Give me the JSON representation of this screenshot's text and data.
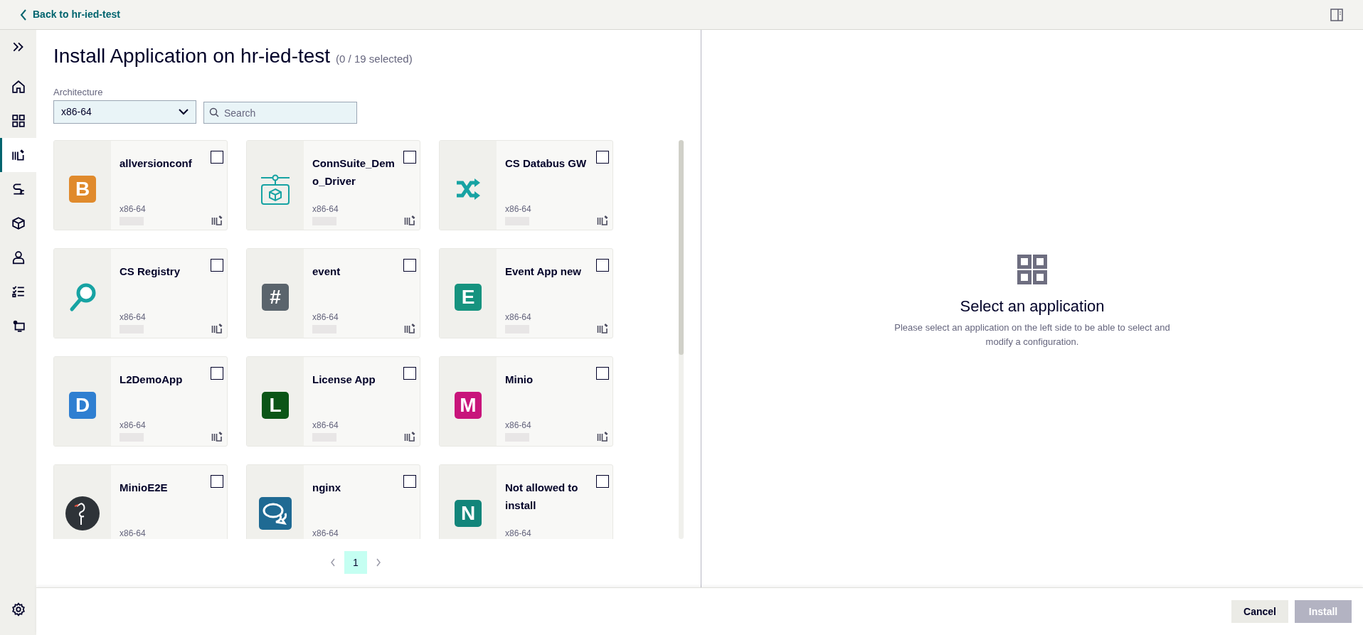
{
  "header": {
    "back_link": "Back to hr-ied-test"
  },
  "sidebar": {
    "items": [
      {
        "kind": "expand",
        "selected": false
      },
      {
        "kind": "home",
        "selected": false
      },
      {
        "kind": "grid",
        "selected": false
      },
      {
        "kind": "apps",
        "selected": true
      },
      {
        "kind": "plug",
        "selected": false
      },
      {
        "kind": "cube",
        "selected": false
      },
      {
        "kind": "user",
        "selected": false
      },
      {
        "kind": "checklist",
        "selected": false
      },
      {
        "kind": "device",
        "selected": false
      }
    ],
    "bottom_item": {
      "kind": "settings",
      "selected": false
    }
  },
  "page": {
    "title": "Install Application on hr-ied-test",
    "selection_count": "(0 / 19 selected)"
  },
  "filters": {
    "architecture": {
      "label": "Architecture",
      "value": "x86-64"
    },
    "search": {
      "placeholder": "Search"
    }
  },
  "apps": [
    {
      "name": "allversionconf",
      "arch": "x86-64",
      "checked": false,
      "icon": {
        "kind": "letter",
        "letter": "B",
        "color": "#e08a2c"
      }
    },
    {
      "name": "ConnSuite_Demo_Driver",
      "arch": "x86-64",
      "checked": false,
      "icon": {
        "kind": "connector",
        "color": "#17a3a3"
      }
    },
    {
      "name": "CS Databus GW",
      "arch": "x86-64",
      "checked": false,
      "icon": {
        "kind": "shuffle",
        "color": "#17a3a3"
      }
    },
    {
      "name": "CS Registry",
      "arch": "x86-64",
      "checked": false,
      "icon": {
        "kind": "magnifier",
        "color": "#17a3a3"
      }
    },
    {
      "name": "event",
      "arch": "x86-64",
      "checked": false,
      "icon": {
        "kind": "letter",
        "letter": "#",
        "color": "#5a646c"
      }
    },
    {
      "name": "Event App new",
      "arch": "x86-64",
      "checked": false,
      "icon": {
        "kind": "letter",
        "letter": "E",
        "color": "#16937f"
      }
    },
    {
      "name": "L2DemoApp",
      "arch": "x86-64",
      "checked": false,
      "icon": {
        "kind": "letter",
        "letter": "D",
        "color": "#2f7fd1"
      }
    },
    {
      "name": "License App",
      "arch": "x86-64",
      "checked": false,
      "icon": {
        "kind": "letter",
        "letter": "L",
        "color": "#0b5517"
      }
    },
    {
      "name": "Minio",
      "arch": "x86-64",
      "checked": false,
      "icon": {
        "kind": "letter",
        "letter": "M",
        "color": "#c8157b"
      }
    },
    {
      "name": "MinioE2E",
      "arch": "x86-64",
      "checked": false,
      "icon": {
        "kind": "bird",
        "color": "#2e3338"
      }
    },
    {
      "name": "nginx",
      "arch": "x86-64",
      "checked": false,
      "icon": {
        "kind": "chat",
        "color": "#1f6a93"
      }
    },
    {
      "name": "Not allowed to install",
      "arch": "x86-64",
      "checked": false,
      "icon": {
        "kind": "letter",
        "letter": "N",
        "color": "#12857a"
      }
    }
  ],
  "pagination": {
    "pages": [
      {
        "label": "1",
        "selected": true
      }
    ]
  },
  "detail": {
    "title": "Select an application",
    "text": "Please select an application on the left side to be able to select and modify a configuration."
  },
  "footer": {
    "buttons": [
      {
        "label": "Cancel",
        "disabled": false,
        "kind": "secondary"
      },
      {
        "label": "Install",
        "disabled": true,
        "kind": "primary"
      }
    ]
  }
}
